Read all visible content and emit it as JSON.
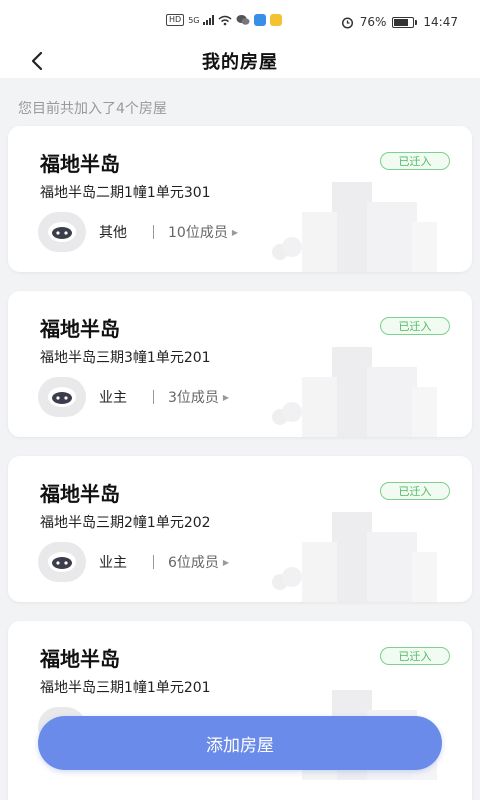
{
  "status_bar": {
    "badge1": "HD",
    "badge2": "5G",
    "battery": "76%",
    "time": "14:47"
  },
  "header": {
    "title": "我的房屋"
  },
  "summary": "您目前共加入了4个房屋",
  "houses": [
    {
      "name": "福地半岛",
      "status": "已迁入",
      "address": "福地半岛二期1幢1单元301",
      "role": "其他",
      "members": "10位成员"
    },
    {
      "name": "福地半岛",
      "status": "已迁入",
      "address": "福地半岛三期3幢1单元201",
      "role": "业主",
      "members": "3位成员"
    },
    {
      "name": "福地半岛",
      "status": "已迁入",
      "address": "福地半岛三期2幢1单元202",
      "role": "业主",
      "members": "6位成员"
    },
    {
      "name": "福地半岛",
      "status": "已迁入",
      "address": "福地半岛三期1幢1单元201"
    }
  ],
  "add_button": "添加房屋",
  "colors": {
    "accent": "#6b8bea",
    "status_green": "#4dbb61"
  },
  "icons": {
    "back": "back-arrow-icon",
    "avatar": "robot-avatar-icon",
    "arrow": "triangle-right-icon"
  }
}
